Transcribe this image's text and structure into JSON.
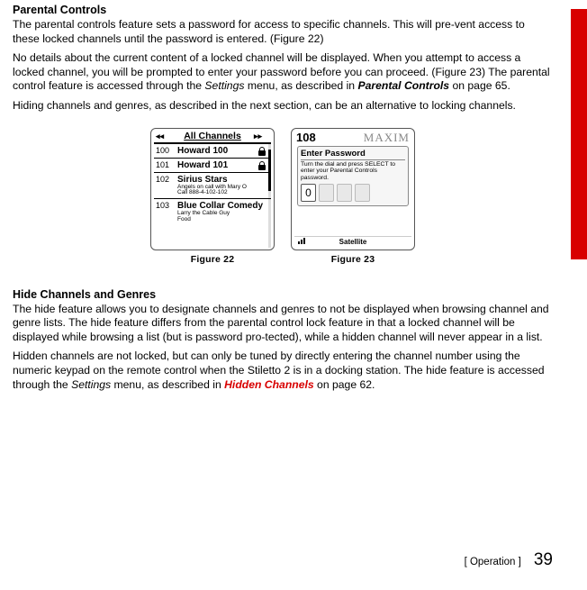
{
  "section1": {
    "heading": "Parental Controls",
    "p1a": "The parental controls feature sets a password for access to specific channels. This will pre-vent access to these locked channels until the password is entered. (Figure 22)",
    "p2a": "No details about the current content of a locked channel will be displayed. When you attempt to access a locked channel, you will be prompted to enter your password before you can proceed. (Figure 23) The parental control feature is accessed through the ",
    "p2_settings": "Settings",
    "p2b": " menu, as described in ",
    "p2_ref": "Parental Controls",
    "p2c": " on page 65.",
    "p3": "Hiding channels and genres, as described in the next section, can be an alternative to locking channels."
  },
  "fig22": {
    "caption": "Figure 22",
    "header": "All Channels",
    "arrL": "◂◂",
    "arrR": "▸▸",
    "rows": [
      {
        "num": "100",
        "name": "Howard 100",
        "locked": true
      },
      {
        "num": "101",
        "name": "Howard 101",
        "locked": true
      },
      {
        "num": "102",
        "name": "Sirius Stars",
        "sub1": "Angels on call with Mary O",
        "sub2": "Call 888-4-102-102"
      },
      {
        "num": "103",
        "name": "Blue Collar Comedy",
        "sub1": "Larry the Cable Guy",
        "sub2": "Food"
      }
    ]
  },
  "fig23": {
    "caption": "Figure 23",
    "channel": "108",
    "brand": "MAXIM",
    "title": "Enter Password",
    "instr": "Turn the dial and press SELECT to enter your Parental Controls password.",
    "pin0": "0",
    "footer": "Satellite"
  },
  "section2": {
    "heading": "Hide Channels and Genres",
    "p1": "The hide feature allows you to designate channels and genres to not be displayed when browsing channel and genre lists. The hide feature differs from the parental control lock feature in that a locked channel will be displayed while browsing a list (but is password pro-tected), while a hidden channel will never appear in a list.",
    "p2a": "Hidden channels are not locked, but can only be tuned by directly entering the channel number using the numeric keypad on the remote control when the Stiletto 2 is in a docking station. The hide feature is accessed through the ",
    "p2_settings": "Settings",
    "p2b": " menu, as described in ",
    "p2_ref": "Hidden Channels",
    "p2c": " on page 62."
  },
  "footer": {
    "b1": "[ ",
    "label": "Operation",
    "b2": " ]",
    "page": "39"
  }
}
